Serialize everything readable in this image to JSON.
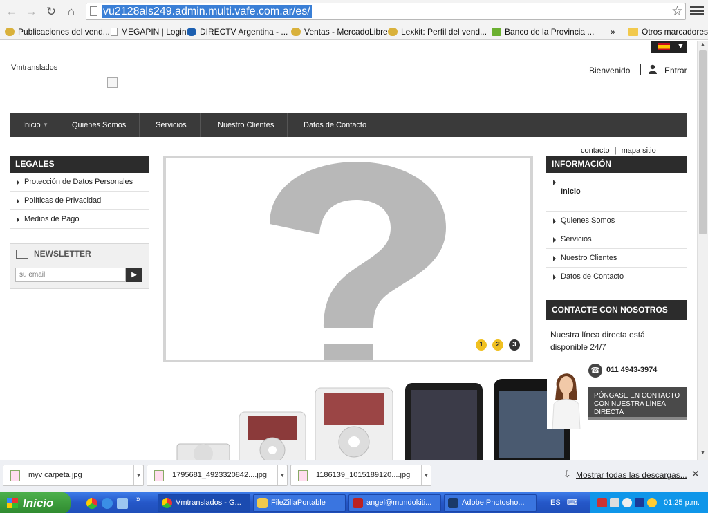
{
  "browser": {
    "url": "vu2128als249.admin.multi.vafe.com.ar/es/",
    "bookmarks": [
      "Publicaciones del vend...",
      "MEGAPIN | Login",
      "DIRECTV Argentina - ...",
      "Ventas - MercadoLibre",
      "Lexkit: Perfil del vend...",
      "Banco de la Provincia ...",
      "»",
      "Otros marcadores"
    ]
  },
  "site": {
    "logo_text": "Vmtranslados",
    "welcome": "Bienvenido",
    "login": "Entrar",
    "nav": [
      "Inicio",
      "Quienes Somos",
      "Servicios",
      "Nuestro Clientes",
      "Datos de Contacto"
    ],
    "top_links": [
      "contacto",
      "|",
      "mapa sitio"
    ],
    "legales": {
      "title": "LEGALES",
      "items": [
        "Protección de Datos Personales",
        "Políticas de Privacidad",
        "Medios de Pago"
      ]
    },
    "newsletter": {
      "title": "NEWSLETTER",
      "placeholder": "su email"
    },
    "slider": {
      "pages": [
        "1",
        "2",
        "3"
      ],
      "active_page": 3
    },
    "informacion": {
      "title": "INFORMACIÓN",
      "items": [
        "Inicio",
        "Quienes Somos",
        "Servicios",
        "Nuestro Clientes",
        "Datos de Contacto"
      ]
    },
    "contacte": {
      "title": "CONTACTE CON NOSOTROS",
      "text": "Nuestra línea directa está disponible 24/7",
      "phone": "011 4943-3974",
      "button": "PÓNGASE EN CONTACTO CON NUESTRA LÍNEA DIRECTA"
    }
  },
  "downloads": {
    "files": [
      "myv carpeta.jpg",
      "1795681_4923320842....jpg",
      "1186139_1015189120....jpg"
    ],
    "show_all": "Mostrar todas las descargas..."
  },
  "taskbar": {
    "start": "Inicio",
    "tasks": [
      "Vmtranslados - G...",
      "FileZillaPortable",
      "angel@mundokiti...",
      "Adobe Photosho..."
    ],
    "lang": "ES",
    "clock": "01:25 p.m."
  },
  "colors": {
    "nav_bg": "#3a3a3a",
    "box_header": "#2c2c2c",
    "slider_dot": "#f0c020",
    "taskbar": "#2557c8",
    "start": "#3a9a3a"
  }
}
